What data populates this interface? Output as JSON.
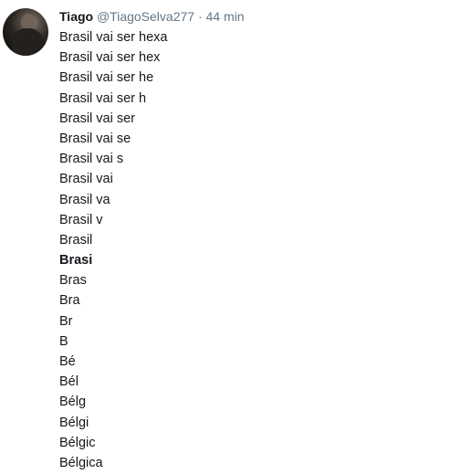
{
  "tweet": {
    "author_name": "Tiago",
    "author_handle": "@TiagoSelva277",
    "separator": "·",
    "timestamp": "44 min",
    "avatar_icon": "user-avatar",
    "lines": [
      {
        "text": "Brasil vai ser hexa",
        "bold": false
      },
      {
        "text": "Brasil vai ser hex",
        "bold": false
      },
      {
        "text": "Brasil vai ser he",
        "bold": false
      },
      {
        "text": "Brasil vai ser h",
        "bold": false
      },
      {
        "text": "Brasil vai ser",
        "bold": false
      },
      {
        "text": "Brasil vai se",
        "bold": false
      },
      {
        "text": "Brasil vai s",
        "bold": false
      },
      {
        "text": "Brasil vai",
        "bold": false
      },
      {
        "text": "Brasil va",
        "bold": false
      },
      {
        "text": "Brasil v",
        "bold": false
      },
      {
        "text": "Brasil",
        "bold": false
      },
      {
        "text": "Brasi",
        "bold": true
      },
      {
        "text": "Bras",
        "bold": false
      },
      {
        "text": "Bra",
        "bold": false
      },
      {
        "text": "Br",
        "bold": false
      },
      {
        "text": "B",
        "bold": false
      },
      {
        "text": "Bé",
        "bold": false
      },
      {
        "text": "Bél",
        "bold": false
      },
      {
        "text": "Bélg",
        "bold": false
      },
      {
        "text": "Bélgi",
        "bold": false
      },
      {
        "text": "Bélgic",
        "bold": false
      },
      {
        "text": "Bélgica",
        "bold": false
      }
    ]
  }
}
